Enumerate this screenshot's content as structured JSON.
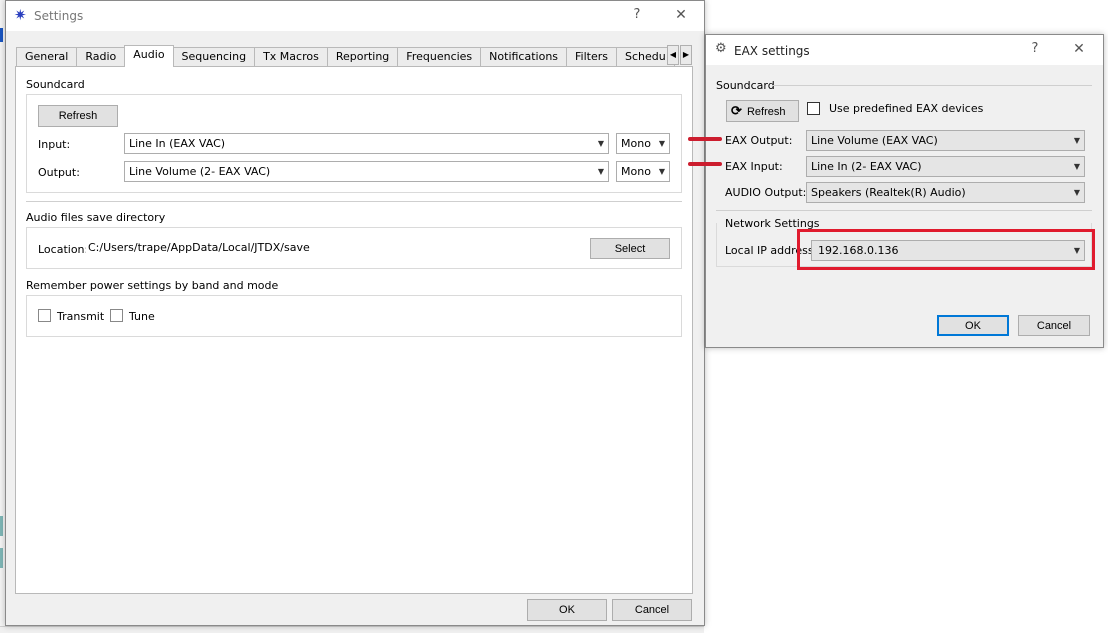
{
  "settings_window": {
    "title": "Settings",
    "help": "?",
    "close": "✕",
    "tabs": [
      "General",
      "Radio",
      "Audio",
      "Sequencing",
      "Tx Macros",
      "Reporting",
      "Frequencies",
      "Notifications",
      "Filters",
      "Schedu"
    ],
    "active_tab": "Audio",
    "soundcard": {
      "label": "Soundcard",
      "refresh": "Refresh",
      "input_label": "Input:",
      "input_value": "Line In (EAX VAC)",
      "input_channel": "Mono",
      "output_label": "Output:",
      "output_value": "Line Volume (2- EAX VAC)",
      "output_channel": "Mono"
    },
    "save_dir": {
      "label": "Audio files save directory",
      "location_label": "Location:",
      "location_value": "C:/Users/trape/AppData/Local/JTDX/save",
      "select": "Select"
    },
    "power": {
      "label": "Remember power settings by band and mode",
      "transmit": "Transmit",
      "tune": "Tune"
    },
    "ok": "OK",
    "cancel": "Cancel"
  },
  "eax_window": {
    "title": "EAX settings",
    "help": "?",
    "close": "✕",
    "soundcard_label": "Soundcard",
    "refresh": "Refresh",
    "predefined_label": "Use predefined EAX devices",
    "eax_output_label": "EAX Output:",
    "eax_output_value": "Line Volume (EAX VAC)",
    "eax_input_label": "EAX Input:",
    "eax_input_value": "Line In (2- EAX VAC)",
    "audio_output_label": "AUDIO Output:",
    "audio_output_value": "Speakers (Realtek(R) Audio)",
    "network_label": "Network Settings",
    "local_ip_label": "Local IP address:",
    "local_ip_value": "192.168.0.136",
    "ok": "OK",
    "cancel": "Cancel"
  },
  "colors": {
    "annotation_red": "#e01b2e",
    "default_button_border": "#0078d7"
  }
}
